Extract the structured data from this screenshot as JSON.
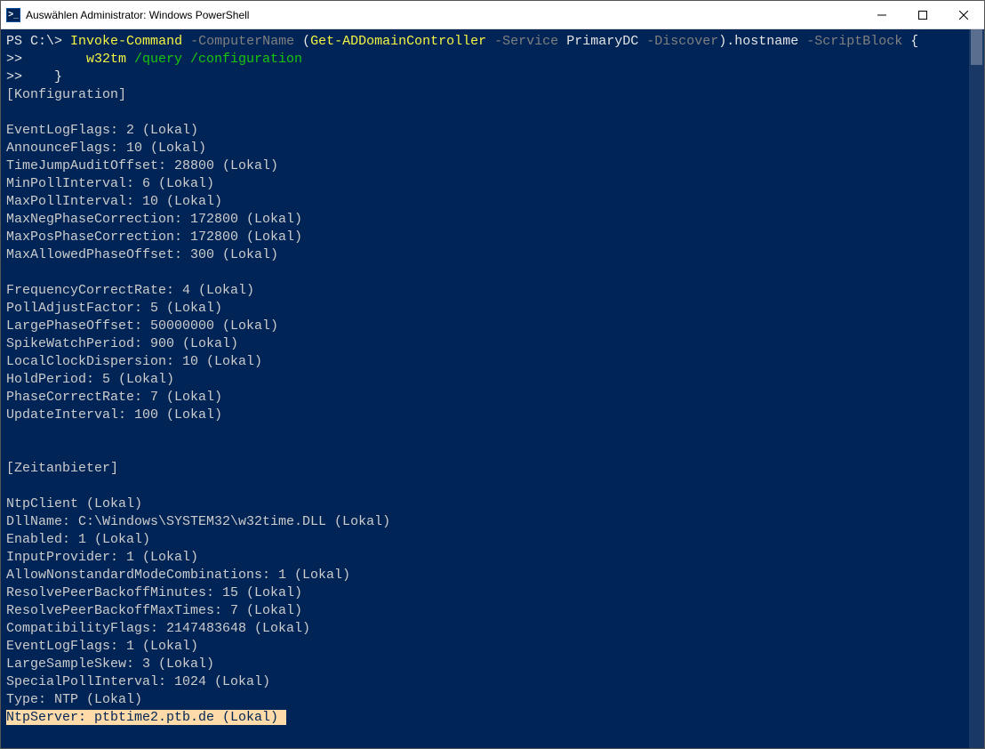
{
  "window": {
    "title": "Auswählen Administrator: Windows PowerShell"
  },
  "prompt": {
    "ps_prefix": "PS ",
    "path": "C:\\",
    "gt": "> ",
    "cmd": "Invoke-Command",
    "flag_computer": " -ComputerName ",
    "paren_open": "(",
    "get_add": "Get-ADDomainController",
    "flag_service": " -Service ",
    "primary": "PrimaryDC",
    "flag_discover": " -Discover",
    "paren_close": ")",
    "dot_hostname": ".hostname",
    "flag_scriptblock": " -ScriptBlock ",
    "brace_open": "{",
    "cont1_prefix": ">>        ",
    "w32tm": "w32tm",
    "w32_args": " /query /configuration",
    "cont2_prefix": ">>    ",
    "brace_close": "}"
  },
  "output": {
    "section1": "[Konfiguration]",
    "cfg": [
      "EventLogFlags: 2 (Lokal)",
      "AnnounceFlags: 10 (Lokal)",
      "TimeJumpAuditOffset: 28800 (Lokal)",
      "MinPollInterval: 6 (Lokal)",
      "MaxPollInterval: 10 (Lokal)",
      "MaxNegPhaseCorrection: 172800 (Lokal)",
      "MaxPosPhaseCorrection: 172800 (Lokal)",
      "MaxAllowedPhaseOffset: 300 (Lokal)"
    ],
    "cfg2": [
      "FrequencyCorrectRate: 4 (Lokal)",
      "PollAdjustFactor: 5 (Lokal)",
      "LargePhaseOffset: 50000000 (Lokal)",
      "SpikeWatchPeriod: 900 (Lokal)",
      "LocalClockDispersion: 10 (Lokal)",
      "HoldPeriod: 5 (Lokal)",
      "PhaseCorrectRate: 7 (Lokal)",
      "UpdateInterval: 100 (Lokal)"
    ],
    "section2": "[Zeitanbieter]",
    "prov": [
      "NtpClient (Lokal)",
      "DllName: C:\\Windows\\SYSTEM32\\w32time.DLL (Lokal)",
      "Enabled: 1 (Lokal)",
      "InputProvider: 1 (Lokal)",
      "AllowNonstandardModeCombinations: 1 (Lokal)",
      "ResolvePeerBackoffMinutes: 15 (Lokal)",
      "ResolvePeerBackoffMaxTimes: 7 (Lokal)",
      "CompatibilityFlags: 2147483648 (Lokal)",
      "EventLogFlags: 1 (Lokal)",
      "LargeSampleSkew: 3 (Lokal)",
      "SpecialPollInterval: 1024 (Lokal)",
      "Type: NTP (Lokal)"
    ],
    "highlighted": "NtpServer: ptbtime2.ptb.de (Lokal) "
  }
}
